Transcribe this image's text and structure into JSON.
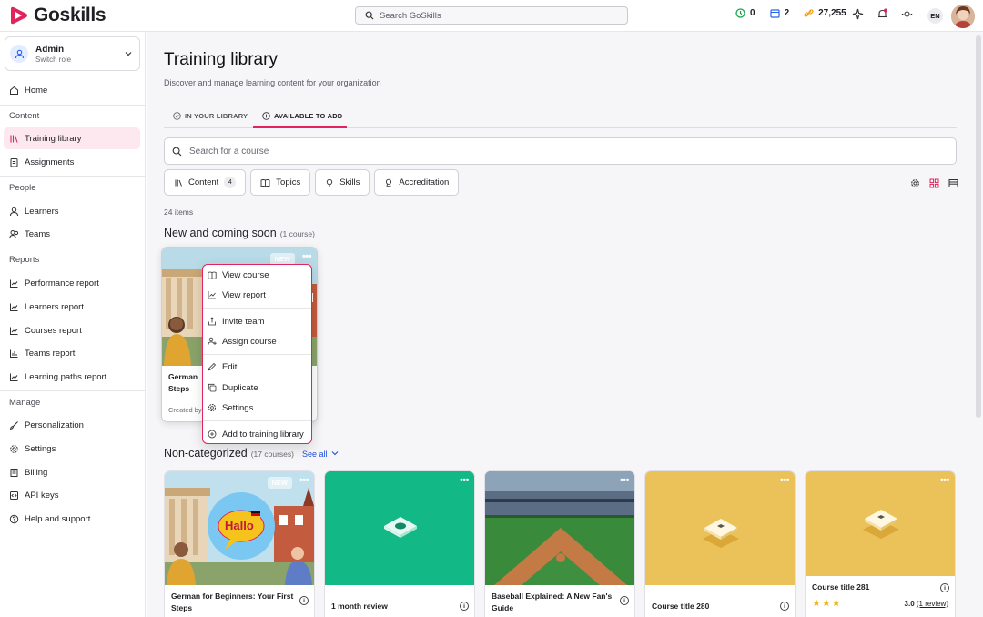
{
  "app": {
    "name": "Goskills",
    "brand_color": "#e0245e"
  },
  "topbar": {
    "search_placeholder": "Search GoSkills",
    "stats": {
      "streak": "0",
      "calendar": "2",
      "points": "27,255"
    },
    "lang": "EN"
  },
  "sidebar": {
    "role": {
      "name": "Admin",
      "sub": "Switch role"
    },
    "home": "Home",
    "sections": {
      "content": "Content",
      "people": "People",
      "reports": "Reports",
      "manage": "Manage"
    },
    "items": {
      "training_library": "Training library",
      "assignments": "Assignments",
      "learners": "Learners",
      "teams": "Teams",
      "performance_report": "Performance report",
      "learners_report": "Learners report",
      "courses_report": "Courses report",
      "teams_report": "Teams report",
      "learning_paths_report": "Learning paths report",
      "personalization": "Personalization",
      "settings": "Settings",
      "billing": "Billing",
      "api_keys": "API keys",
      "help": "Help and support"
    }
  },
  "main": {
    "title": "Training library",
    "subtitle": "Discover and manage learning content for your organization",
    "tabs": {
      "in_library": "IN YOUR LIBRARY",
      "available": "AVAILABLE TO ADD"
    },
    "search_placeholder": "Search for a course",
    "filters": {
      "content": "Content",
      "content_count": "4",
      "topics": "Topics",
      "skills": "Skills",
      "accreditation": "Accreditation"
    },
    "items_count": "24 items",
    "section_new": {
      "title": "New and coming soon",
      "count": "(1 course)"
    },
    "section_noncat": {
      "title": "Non-categorized",
      "count": "(17 courses)",
      "see_all": "See all"
    },
    "featured_card": {
      "new_tag": "NEW",
      "title_line1": "German",
      "title_line2": "Steps",
      "created_by": "Created by"
    },
    "cards": [
      {
        "title": "German for Beginners: Your First Steps",
        "new_tag": "NEW",
        "hallo": "Hallo"
      },
      {
        "title": "1 month review"
      },
      {
        "title": "Baseball Explained: A New Fan's Guide"
      },
      {
        "title": "Course title 280"
      },
      {
        "title": "Course title 281",
        "rating": "3.0",
        "reviews": "(1 review)"
      }
    ]
  },
  "context_menu": {
    "view_course": "View course",
    "view_report": "View report",
    "invite_team": "Invite team",
    "assign_course": "Assign course",
    "edit": "Edit",
    "duplicate": "Duplicate",
    "settings": "Settings",
    "add_to_library": "Add to training library"
  }
}
